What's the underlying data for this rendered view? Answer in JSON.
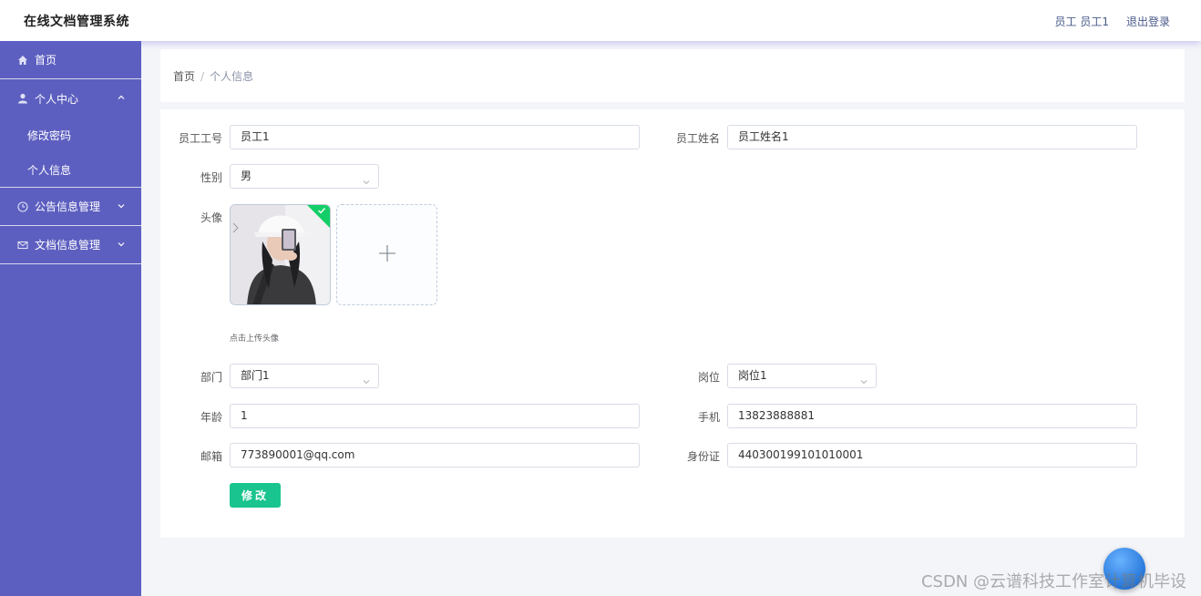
{
  "header": {
    "title": "在线文档管理系统",
    "user": "员工 员工1",
    "logout": "退出登录"
  },
  "sidebar": {
    "items": [
      {
        "label": "首页",
        "icon": "home-icon"
      },
      {
        "label": "个人中心",
        "icon": "user-icon",
        "expanded": true,
        "children": [
          {
            "label": "修改密码"
          },
          {
            "label": "个人信息"
          }
        ]
      },
      {
        "label": "公告信息管理",
        "icon": "clock-icon"
      },
      {
        "label": "文档信息管理",
        "icon": "mail-icon"
      }
    ]
  },
  "breadcrumb": {
    "home": "首页",
    "separator": "/",
    "current": "个人信息"
  },
  "form": {
    "employee_id": {
      "label": "员工工号",
      "value": "员工1"
    },
    "employee_name": {
      "label": "员工姓名",
      "value": "员工姓名1"
    },
    "gender": {
      "label": "性别",
      "value": "男"
    },
    "avatar": {
      "label": "头像",
      "hint": "点击上传头像"
    },
    "department": {
      "label": "部门",
      "value": "部门1"
    },
    "position": {
      "label": "岗位",
      "value": "岗位1"
    },
    "age": {
      "label": "年龄",
      "value": "1"
    },
    "phone": {
      "label": "手机",
      "value": "13823888881"
    },
    "email": {
      "label": "邮箱",
      "value": "773890001@qq.com"
    },
    "id_card": {
      "label": "身份证",
      "value": "440300199101010001"
    },
    "submit_label": "修改"
  },
  "watermark": "CSDN @云谱科技工作室计算机毕设",
  "colors": {
    "sidebar_bg": "#5d5fc0",
    "primary_button": "#19c48e",
    "success_badge": "#13ce66"
  }
}
